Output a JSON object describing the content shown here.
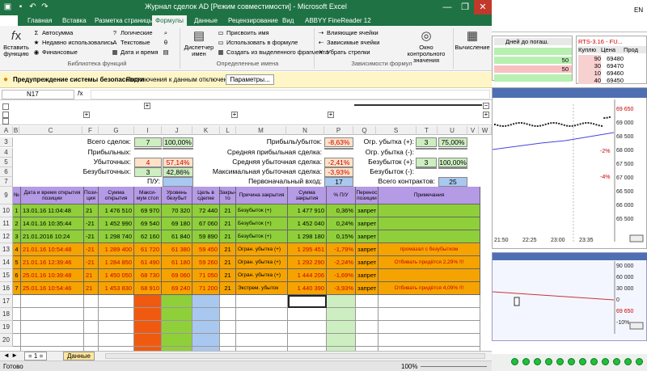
{
  "window": {
    "title": "Журнал сделок AD  [Режим совместимости]  -  Microsoft Excel"
  },
  "tabs": [
    "Главная",
    "Вставка",
    "Разметка страницы",
    "Формулы",
    "Данные",
    "Рецензирование",
    "Вид",
    "ABBYY FineReader 12"
  ],
  "ribbon": {
    "insert_function": "Вставить функцию",
    "autosum": "Автосумма",
    "recent": "Недавно использовались",
    "financial": "Финансовые",
    "logical": "Логические",
    "text": "Текстовые",
    "datetime": "Дата и время",
    "group_library": "Библиотека функций",
    "name_manager": "Диспетчер имен",
    "assign_name": "Присвоить имя",
    "use_in_formula": "Использовать в формуле",
    "create_from_selection": "Создать из выделенного фрагмента",
    "group_names": "Определенные имена",
    "trace_precedents": "Влияющие ячейки",
    "trace_dependents": "Зависимые ячейки",
    "remove_arrows": "Убрать стрелки",
    "watch_window": "Окно контрольного значения",
    "group_audit": "Зависимости формул",
    "calculation": "Вычисление"
  },
  "security": {
    "title": "Предупреждение системы безопасности",
    "message": "Подключения к данным отключены",
    "button": "Параметры..."
  },
  "name_box": "N17",
  "columns": [
    "A",
    "B",
    "C",
    "F",
    "G",
    "I",
    "J",
    "K",
    "L",
    "M",
    "N",
    "P",
    "Q",
    "S",
    "T",
    "U",
    "V",
    "W"
  ],
  "summary": {
    "total_label": "Всего сделок:",
    "total": "7",
    "total_pct": "100,00%",
    "profit_label": "Прибыльных:",
    "loss_label": "Убыточных:",
    "loss": "4",
    "loss_pct": "57,14%",
    "be_label": "Безубыточных:",
    "be": "3",
    "be_pct": "42,86%",
    "pl_label": "П/У:",
    "pnl_label": "Прибыль/убыток:",
    "pnl": "-8,63%",
    "avg_win_label": "Средняя прибыльная сделка:",
    "avg_loss_label": "Средняя убыточная сделка:",
    "avg_loss": "-2,41%",
    "max_loss_label": "Максимальная убыточная сделка:",
    "max_loss": "-3,93%",
    "first_entry_label": "Первоначальный вход:",
    "first_entry": "17",
    "lim_loss_plus_label": "Огр. убытка (+):",
    "lim_loss_plus": "3",
    "lim_loss_plus_pct": "75,00%",
    "lim_loss_minus_label": "Огр. убытка (-):",
    "be_plus_label": "Безубыток (+):",
    "be_plus": "3",
    "be_plus_pct": "100,00%",
    "be_minus_label": "Безубыток (-):",
    "contracts_label": "Всего контрактов:",
    "contracts": "25"
  },
  "table_headers": [
    "№",
    "Дата и время открытия позиции",
    "Пози-ция",
    "Сумма открытия",
    "Макси-мум стоп",
    "Уровень безубыт",
    "Цель в сделке",
    "Закры-то",
    "Причина закрытия",
    "Сумма закрытия",
    "% П/У",
    "Перенос позиции",
    "Примечания"
  ],
  "trades": [
    {
      "n": "1",
      "date": "13.01.16 11:04:48",
      "pos": "21",
      "open": "1 476 510",
      "stop": "69 970",
      "be": "70 320",
      "target": "72 440",
      "closed": "21",
      "reason": "Безубыток (+)",
      "close": "1 477 910",
      "pct": "0,36%",
      "transfer": "запрет",
      "note": "",
      "color": "green"
    },
    {
      "n": "2",
      "date": "14.01.16 10:35:44",
      "pos": "-21",
      "open": "1 452 990",
      "stop": "69 540",
      "be": "69 180",
      "target": "67 060",
      "closed": "21",
      "reason": "Безубыток (+)",
      "close": "1 452 040",
      "pct": "0,24%",
      "transfer": "запрет",
      "note": "",
      "color": "green"
    },
    {
      "n": "3",
      "date": "21.01.2016 10:24",
      "pos": "-21",
      "open": "1 298 740",
      "stop": "62 160",
      "be": "61 840",
      "target": "59 890",
      "closed": "21",
      "reason": "Безубыток (+)",
      "close": "1 298 180",
      "pct": "0,15%",
      "transfer": "запрет",
      "note": "",
      "color": "green"
    },
    {
      "n": "4",
      "date": "21.01.16 10:54:48",
      "pos": "-21",
      "open": "1 289 400",
      "stop": "61 720",
      "be": "61 380",
      "target": "59 450",
      "closed": "21",
      "reason": "Огран. убытка (+)",
      "close": "1 295 451",
      "pct": "-1,79%",
      "transfer": "запрет",
      "note": "промазал с безубытком",
      "color": "orange"
    },
    {
      "n": "5",
      "date": "21.01.16 12:39:46",
      "pos": "-21",
      "open": "1 284 850",
      "stop": "61 490",
      "be": "61 180",
      "target": "59 260",
      "closed": "21",
      "reason": "Огран. убытка (+)",
      "close": "1 292 290",
      "pct": "-2,24%",
      "transfer": "запрет",
      "note": "Отбивать придётся 2,29% !!!",
      "color": "orange"
    },
    {
      "n": "6",
      "date": "25.01.16 10:39:48",
      "pos": "21",
      "open": "1 450 050",
      "stop": "68 730",
      "be": "69 060",
      "target": "71 050",
      "closed": "21",
      "reason": "Огран. убытка (+)",
      "close": "1 444 206",
      "pct": "-1,69%",
      "transfer": "запрет",
      "note": "",
      "color": "orange"
    },
    {
      "n": "7",
      "date": "25.01.16 10:54:46",
      "pos": "21",
      "open": "1 453 830",
      "stop": "68 910",
      "be": "69 240",
      "target": "71 200",
      "closed": "21",
      "reason": "Экстрем. убыток",
      "close": "1 440 390",
      "pct": "-3,93%",
      "transfer": "запрет",
      "note": "Отбивать придётся 4,09% !!!",
      "color": "orange"
    }
  ],
  "row_numbers": [
    "1",
    "2",
    "3",
    "4",
    "5",
    "6",
    "7",
    "9",
    "10",
    "11",
    "12",
    "13",
    "14",
    "15",
    "16",
    "17",
    "18",
    "19",
    "20",
    "21"
  ],
  "sheets": [
    "= 1 =",
    "Данные"
  ],
  "status": {
    "ready": "Готово",
    "zoom": "100%"
  },
  "terminal": {
    "lang": "EN",
    "quote_title": "RTS-3.16 - FU...",
    "quote_headers": [
      "Куплю",
      "Цена",
      "Прод"
    ],
    "quotes": [
      [
        "90",
        "69480",
        ""
      ],
      [
        "30",
        "69470",
        ""
      ],
      [
        "10",
        "69460",
        ""
      ],
      [
        "40",
        "69450",
        ""
      ]
    ],
    "left_header": "Дней до погаш.",
    "left_values": [
      "",
      "50",
      "50",
      ""
    ],
    "price_labels": [
      "69 650",
      "69 000",
      "68 500",
      "68 000",
      "67 500",
      "67 000",
      "66 500",
      "66 000",
      "65 500"
    ],
    "time_labels": [
      "21:50",
      "22:25",
      "23:00",
      "23:35"
    ],
    "pct_labels": [
      "-2%",
      "-4%"
    ],
    "lower_labels": [
      "90 000",
      "60 000",
      "30 000",
      "0",
      "69 650",
      "-10%"
    ]
  }
}
